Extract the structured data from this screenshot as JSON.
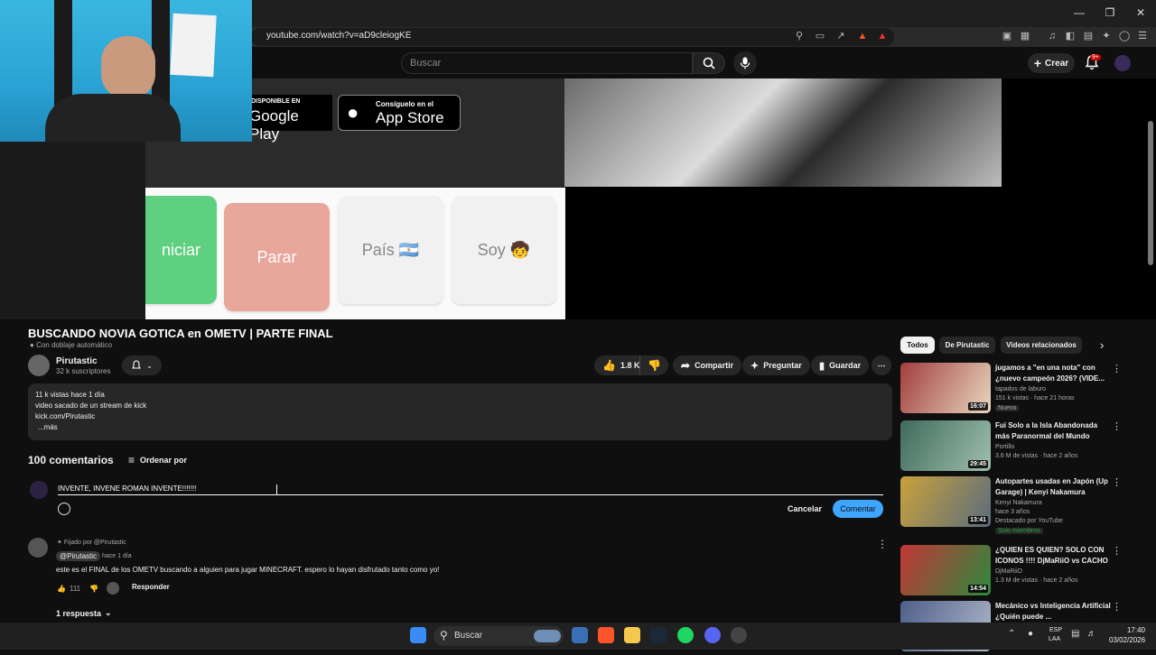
{
  "browser": {
    "url": "youtube.com/watch?v=aD9cleiogKE"
  },
  "youtube_header": {
    "search_placeholder": "Buscar",
    "create_label": "Crear",
    "notifications_badge": "9+"
  },
  "player": {
    "store_badges": [
      {
        "small": "DISPONIBLE EN",
        "big": "Google Play"
      },
      {
        "small": "Consíguelo en el",
        "big": "App Store"
      }
    ],
    "ometv_buttons": [
      {
        "label": "niciar",
        "color": "#5fcf80",
        "text_color": "#ffffff"
      },
      {
        "label": "Parar",
        "color": "#e9a69b",
        "text_color": "#ffffff"
      },
      {
        "label": "País 🇦🇷",
        "color": "#f1f1f1",
        "text_color": "#888888"
      },
      {
        "label": "Soy 🧒",
        "color": "#f1f1f1",
        "text_color": "#888888"
      }
    ]
  },
  "video": {
    "title": "BUSCANDO NOVIA GOTICA en OMETV | PARTE FINAL",
    "dub_note": "Con doblaje automático",
    "channel_name": "Pirutastic",
    "subscribers": "32 k suscriptores",
    "likes": "1.8 K",
    "share_label": "Compartir",
    "ask_label": "Preguntar",
    "save_label": "Guardar",
    "description_lines": [
      "11 k vistas  hace 1 día",
      "video sacado de un stream de kick",
      "kick.com/Pirutastic",
      "...más"
    ]
  },
  "comments": {
    "count_label": "100 comentarios",
    "sort_label": "Ordenar por",
    "draft_text": "INVENTE, INVENE ROMAN INVENTE!!!!!!!",
    "cancel_label": "Cancelar",
    "submit_label": "Comentar",
    "pinned": {
      "pinned_by": "Fijado por @Pirutastic",
      "author": "@Pirutastic",
      "time": "hace 1 día",
      "text": "este es el FINAL de los OMETV buscando a alguien para jugar MINECRAFT. espero lo hayan disfrutado tanto como yo!",
      "likes": "111",
      "reply_label": "Responder",
      "replies_label": "1 respuesta"
    }
  },
  "sidebar": {
    "chips": [
      "Todos",
      "De Pirutastic",
      "Videos relacionados"
    ],
    "recommendations": [
      {
        "title": "jugamos a \"en una nota\" con ¿nuevo campeón 2026? (VIDE...",
        "channel": "tapados de laburo",
        "meta": "151 k vistas · hace 21 horas",
        "badge": "Nuevo",
        "duration": "16:07",
        "thumb": [
          "#a23e3e",
          "#e8d7c0"
        ]
      },
      {
        "title": "Fui Solo a la Isla Abandonada más Paranormal del Mundo",
        "channel": "Portillo",
        "meta": "3.6 M de vistas · hace 2 años",
        "badge": "",
        "duration": "29:45",
        "thumb": [
          "#3f6b5c",
          "#9fbfae"
        ]
      },
      {
        "title": "Autopartes usadas en Japón (Up Garage) | Kenyi Nakamura",
        "channel": "Kenyi Nakamura",
        "meta": "hace 3 años",
        "badge": "Destacado por YouTube",
        "extra": "Solo miembros",
        "duration": "13:41",
        "thumb": [
          "#c9a23a",
          "#5b6c7e"
        ]
      },
      {
        "title": "¿QUIEN ES QUIEN? SOLO CON ICONOS !!!! DjMaRiiO vs CACHO",
        "channel": "DjMaRiiO",
        "meta": "1.3 M de vistas · hace 2 años",
        "badge": "",
        "duration": "14:54",
        "thumb": [
          "#c23636",
          "#2c8a3d"
        ]
      },
      {
        "title": "Mecánico vs Inteligencia Artificial ¿Quién puede ...",
        "channel": "",
        "meta": "",
        "badge": "",
        "duration": "",
        "thumb": [
          "#4f5f8a",
          "#b0b8c9"
        ]
      }
    ]
  },
  "taskbar": {
    "search_label": "Buscar",
    "lang_1": "ESP",
    "lang_2": "LAA",
    "time": "17:40",
    "date": "03/02/2026"
  },
  "colors": {
    "accent_blue": "#3ea6ff",
    "background": "#0f0f0f",
    "surface": "#272727"
  }
}
